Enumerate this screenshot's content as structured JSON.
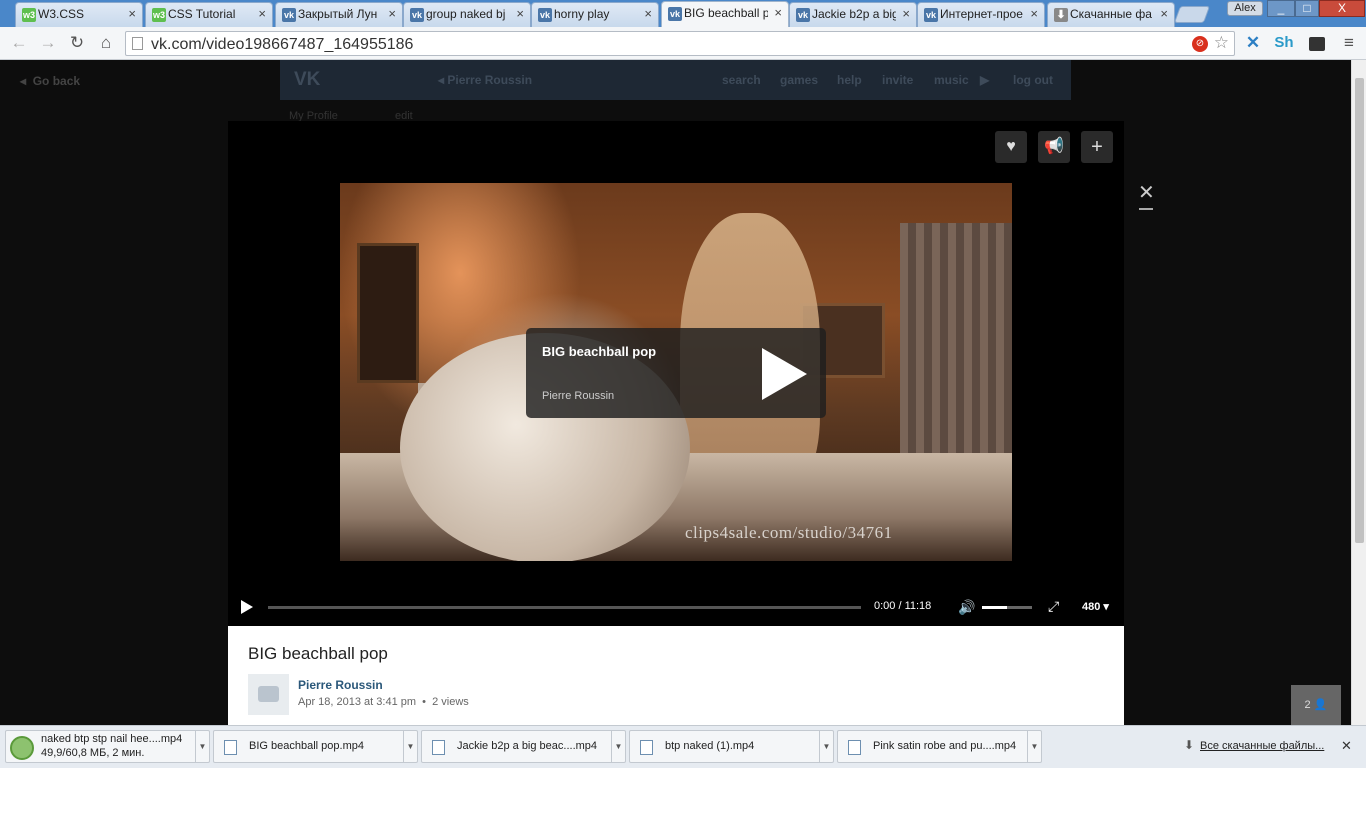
{
  "tabs": [
    {
      "label": "W3.CSS",
      "icon": "w3-icon",
      "color": "#5fbf4f"
    },
    {
      "label": "CSS Tutorial",
      "icon": "w3-icon",
      "color": "#5fbf4f"
    },
    {
      "label": "Закрытый Лун",
      "icon": "vk-icon",
      "color": "#4a76a8"
    },
    {
      "label": "group naked bj",
      "icon": "vk-icon",
      "color": "#4a76a8"
    },
    {
      "label": "horny play",
      "icon": "vk-icon",
      "color": "#4a76a8"
    },
    {
      "label": "BIG beachball p",
      "icon": "vk-icon",
      "color": "#4a76a8",
      "active": true
    },
    {
      "label": "Jackie b2p a big",
      "icon": "vk-icon",
      "color": "#4a76a8"
    },
    {
      "label": "Интернет-прое",
      "icon": "vk-icon",
      "color": "#4a76a8"
    },
    {
      "label": "Скачанные фа",
      "icon": "download-icon",
      "color": "#888888"
    }
  ],
  "window": {
    "user": "Alex",
    "minimize": "_",
    "maximize": "□",
    "close": "X"
  },
  "toolbar": {
    "url": "vk.com/video198667487_164955186"
  },
  "vk": {
    "go_back": "Go back",
    "profile_name": "Pierre Roussin",
    "nav": [
      "search",
      "games",
      "help",
      "invite",
      "music",
      "log out"
    ],
    "sidebar_my_profile": "My Profile",
    "sidebar_edit": "edit"
  },
  "video": {
    "title": "BIG beachball pop",
    "author": "Pierre Roussin",
    "watermark": "clips4sale.com/studio/34761",
    "timecode": "0:00 / 11:18",
    "quality": "480",
    "volume_level": 0.5,
    "progress": 0,
    "date": "Apr 18, 2013 at 3:41 pm",
    "views": "2 views",
    "viewers": "2"
  },
  "downloads": {
    "items": [
      {
        "name": "naked btp stp nail hee....mp4",
        "status": "49,9/60,8 МБ, 2 мин."
      },
      {
        "name": "BIG beachball pop.mp4"
      },
      {
        "name": "Jackie b2p a big beac....mp4"
      },
      {
        "name": "btp naked (1).mp4"
      },
      {
        "name": "Pink satin robe and pu....mp4"
      }
    ],
    "all_label": "Все скачанные файлы..."
  }
}
